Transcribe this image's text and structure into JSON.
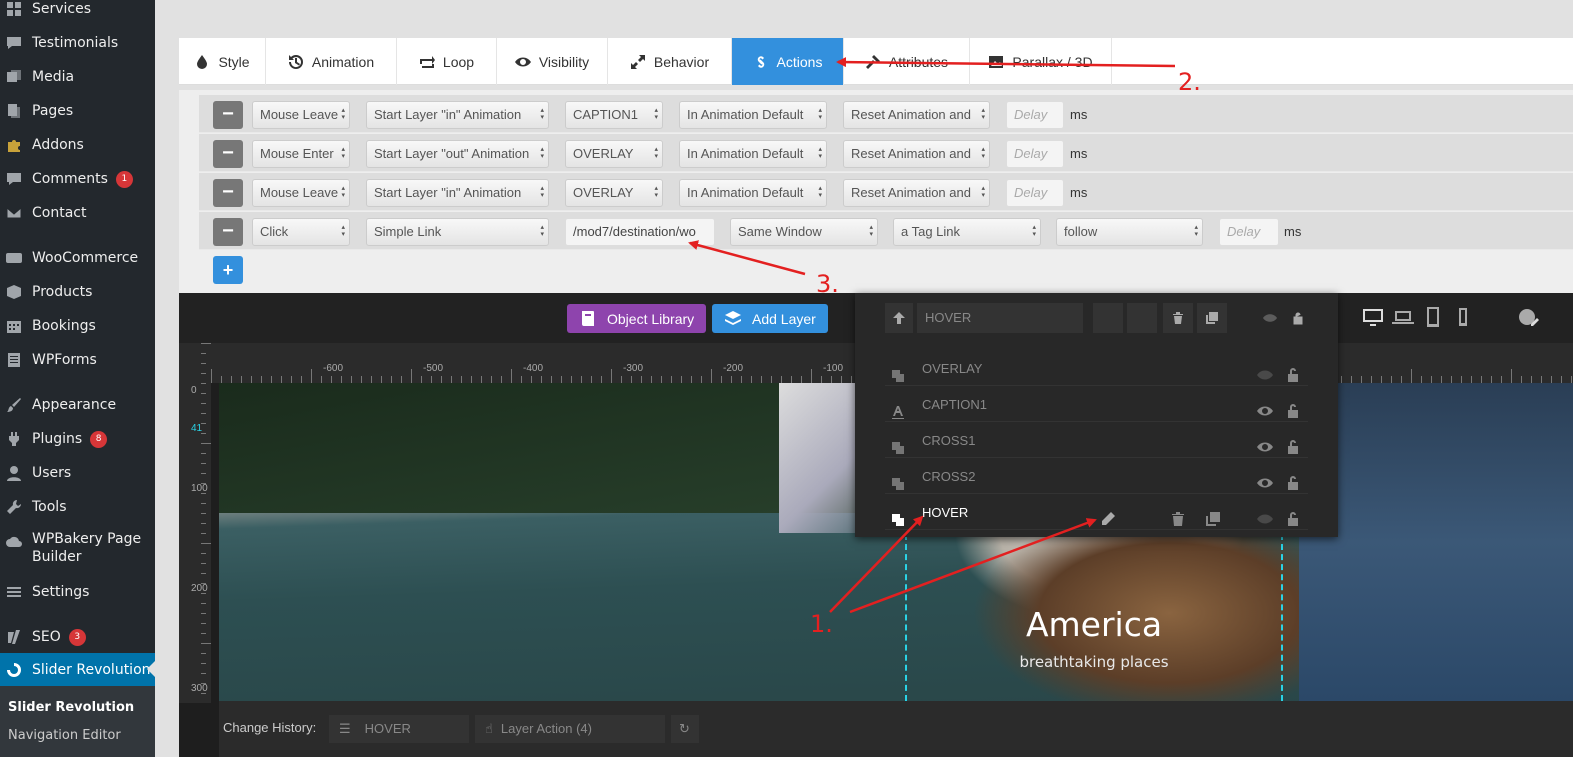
{
  "sidebar": {
    "items": [
      {
        "label": "Services",
        "icon": "grid-icon"
      },
      {
        "label": "Testimonials",
        "icon": "quote-icon"
      },
      {
        "label": "Media",
        "icon": "media-icon"
      },
      {
        "label": "Pages",
        "icon": "pages-icon"
      },
      {
        "label": "Addons",
        "icon": "puzzle-icon"
      },
      {
        "label": "Comments",
        "icon": "comment-icon",
        "badge": "1"
      },
      {
        "label": "Contact",
        "icon": "mail-icon"
      },
      {
        "label": "WooCommerce",
        "icon": "woo-icon"
      },
      {
        "label": "Products",
        "icon": "box-icon"
      },
      {
        "label": "Bookings",
        "icon": "calendar-icon"
      },
      {
        "label": "WPForms",
        "icon": "forms-icon"
      },
      {
        "label": "Appearance",
        "icon": "brush-icon"
      },
      {
        "label": "Plugins",
        "icon": "plug-icon",
        "badge": "8"
      },
      {
        "label": "Users",
        "icon": "user-icon"
      },
      {
        "label": "Tools",
        "icon": "wrench-icon"
      },
      {
        "label": "WPBakery Page",
        "label2": "Builder",
        "icon": "cloud-icon"
      },
      {
        "label": "Settings",
        "icon": "settings-icon"
      },
      {
        "label": "SEO",
        "icon": "yoast-icon",
        "badge": "3"
      },
      {
        "label": "Slider Revolution",
        "icon": "revolution-icon"
      }
    ],
    "submenu": [
      "Slider Revolution",
      "Navigation Editor"
    ]
  },
  "tabs": [
    "Style",
    "Animation",
    "Loop",
    "Visibility",
    "Behavior",
    "Actions",
    "Attributes",
    "Parallax / 3D"
  ],
  "actions": {
    "rows": [
      {
        "event": "Mouse Leave",
        "action": "Start Layer \"in\" Animation",
        "target": "CAPTION1",
        "anim": "In Animation Default",
        "reset": "Reset Animation and",
        "delay": "Delay",
        "unit": "ms"
      },
      {
        "event": "Mouse Enter",
        "action": "Start Layer \"out\" Animation",
        "target": "OVERLAY",
        "anim": "In Animation Default",
        "reset": "Reset Animation and",
        "delay": "Delay",
        "unit": "ms"
      },
      {
        "event": "Mouse Leave",
        "action": "Start Layer \"in\" Animation",
        "target": "OVERLAY",
        "anim": "In Animation Default",
        "reset": "Reset Animation and",
        "delay": "Delay",
        "unit": "ms"
      }
    ],
    "link_row": {
      "event": "Click",
      "action": "Simple Link",
      "url": "/mod7/destination/wo",
      "window": "Same Window",
      "tag": "a Tag Link",
      "rel": "follow",
      "delay": "Delay",
      "unit": "ms"
    },
    "remove_label": "−",
    "add_label": "+"
  },
  "toolbar": {
    "object_library": "Object Library",
    "add_layer": "Add Layer"
  },
  "ruler": {
    "h": [
      "-600",
      "-500",
      "-400",
      "-300",
      "-200",
      "-100"
    ],
    "v": [
      "0",
      "41",
      "100",
      "200",
      "300"
    ]
  },
  "slide": {
    "title": "America",
    "subtitle": "breathtaking places"
  },
  "layers": {
    "header": "HOVER",
    "items": [
      {
        "name": "OVERLAY",
        "icon": "shape-layer-icon"
      },
      {
        "name": "CAPTION1",
        "icon": "text-layer-icon"
      },
      {
        "name": "CROSS1",
        "icon": "shape-layer-icon"
      },
      {
        "name": "CROSS2",
        "icon": "shape-layer-icon"
      },
      {
        "name": "HOVER",
        "icon": "shape-layer-icon"
      }
    ]
  },
  "history": {
    "label": "Change History:",
    "layer": "HOVER",
    "action": "Layer Action (4)"
  },
  "annotations": [
    "1.",
    "2.",
    "3."
  ],
  "colors": {
    "accent": "#3390dd",
    "annotation": "#e32020",
    "sidebar": "#23282d",
    "object_library": "#8e44ad"
  }
}
